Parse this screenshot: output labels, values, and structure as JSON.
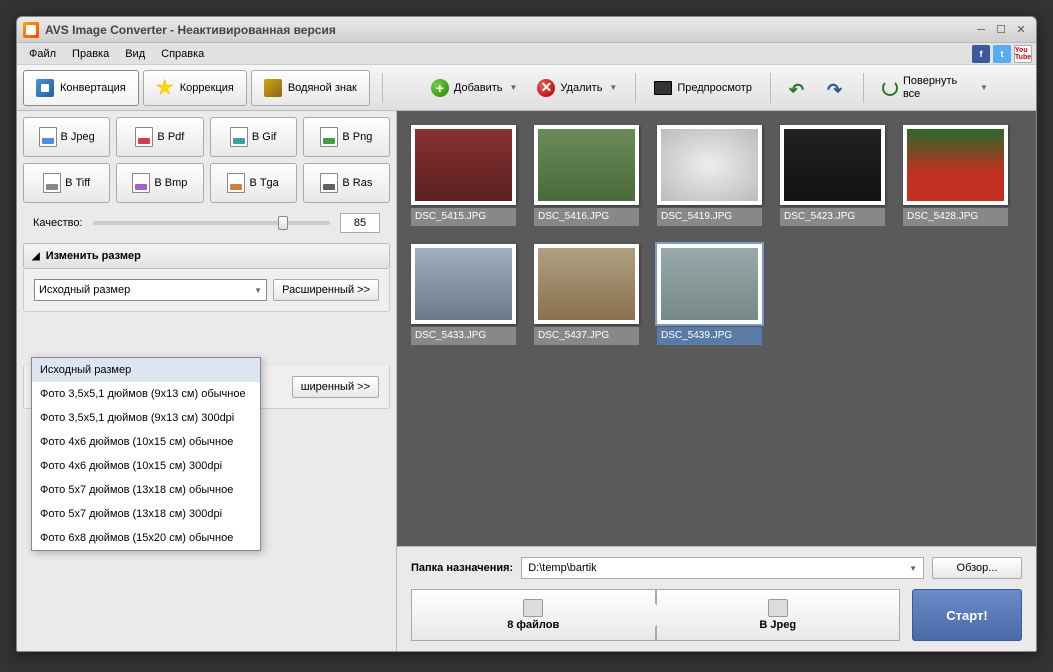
{
  "window": {
    "title": "AVS Image Converter - Неактивированная версия"
  },
  "menu": {
    "file": "Файл",
    "edit": "Правка",
    "view": "Вид",
    "help": "Справка"
  },
  "tabs": {
    "convert": "Конвертация",
    "correct": "Коррекция",
    "watermark": "Водяной знак"
  },
  "toolbar": {
    "add": "Добавить",
    "delete": "Удалить",
    "preview": "Предпросмотр",
    "rotate_all": "Повернуть все"
  },
  "formats": {
    "jpeg": "В Jpeg",
    "pdf": "В Pdf",
    "gif": "В Gif",
    "png": "В Png",
    "tiff": "В Tiff",
    "bmp": "В Bmp",
    "tga": "В Tga",
    "ras": "В Ras"
  },
  "quality": {
    "label": "Качество:",
    "value": "85"
  },
  "resize": {
    "header": "Изменить размер",
    "selected": "Исходный размер",
    "advanced": "Расширенный >>",
    "options": [
      "Исходный размер",
      "Фото 3,5x5,1 дюймов (9x13 см) обычное",
      "Фото 3,5x5,1 дюймов (9x13 см) 300dpi",
      "Фото 4x6 дюймов (10x15 см) обычное",
      "Фото 4x6 дюймов (10x15 см) 300dpi",
      "Фото 5x7 дюймов (13x18 см) обычное",
      "Фото 5x7 дюймов (13x18 см) 300dpi",
      "Фото 6x8 дюймов (15x20 см) обычное"
    ]
  },
  "hidden_advanced": "ширенный >>",
  "thumbs": [
    {
      "label": "DSC_5415.JPG",
      "bg": "linear-gradient(#8a3030,#5a2020)"
    },
    {
      "label": "DSC_5416.JPG",
      "bg": "linear-gradient(#6a8a5a,#4a6a3a)"
    },
    {
      "label": "DSC_5419.JPG",
      "bg": "radial-gradient(#eee,#bbb)"
    },
    {
      "label": "DSC_5423.JPG",
      "bg": "linear-gradient(#222,#111)"
    },
    {
      "label": "DSC_5428.JPG",
      "bg": "linear-gradient(#2a6a2a,#c03020 60%)"
    },
    {
      "label": "DSC_5433.JPG",
      "bg": "linear-gradient(#a0b0c0,#6a7a8a)"
    },
    {
      "label": "DSC_5437.JPG",
      "bg": "linear-gradient(#b0a080,#8a7050)"
    },
    {
      "label": "DSC_5439.JPG",
      "bg": "linear-gradient(#9aa,#788)"
    }
  ],
  "selected_thumb": 7,
  "dest": {
    "label": "Папка назначения:",
    "path": "D:\\temp\\bartik",
    "browse": "Обзор..."
  },
  "summary": {
    "files": "8 файлов",
    "format": "В Jpeg",
    "start": "Старт!"
  }
}
